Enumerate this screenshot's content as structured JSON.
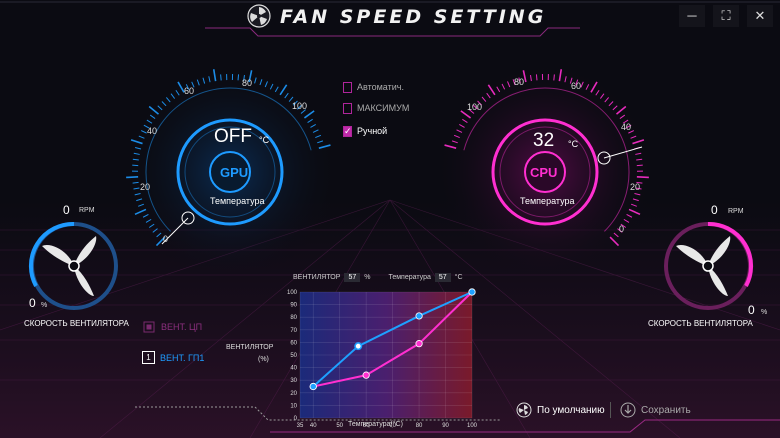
{
  "window": {
    "title": "FAN SPEED SETTING",
    "buttons": {
      "minimize": "─",
      "fullscreen": "⛶",
      "close": "✕"
    }
  },
  "gpu_gauge": {
    "label": "GPU",
    "temperature": "OFF",
    "unit": "°C",
    "caption": "Температура",
    "ticks": [
      "0",
      "20",
      "40",
      "60",
      "80",
      "100"
    ],
    "accent": "#1e9bff",
    "level": 0
  },
  "cpu_gauge": {
    "label": "CPU",
    "temperature": "32",
    "unit": "°C",
    "caption": "Температура",
    "ticks": [
      "0",
      "20",
      "40",
      "60",
      "80",
      "100"
    ],
    "accent": "#ff2fd0",
    "level": 32
  },
  "modes": [
    {
      "label": "Автоматич.",
      "selected": false
    },
    {
      "label": "МАКСИМУМ",
      "selected": false
    },
    {
      "label": "Ручной",
      "selected": true
    }
  ],
  "left_fan": {
    "rpm_value": "0",
    "rpm_unit": "RPM",
    "percent_value": "0",
    "percent_unit": "%",
    "caption": "СКОРОСТЬ ВЕНТИЛЯТОРА"
  },
  "right_fan": {
    "rpm_value": "0",
    "rpm_unit": "RPM",
    "percent_value": "0",
    "percent_unit": "%",
    "caption": "СКОРОСТЬ ВЕНТИЛЯТОРА"
  },
  "fan_selector": {
    "cpu": {
      "icon": "chip-icon",
      "label": "ВЕНТ. ЦП"
    },
    "gpu": {
      "icon": "chip-icon",
      "number": "1",
      "label": "ВЕНТ. ГП1"
    }
  },
  "readout": {
    "fan_label": "ВЕНТИЛЯТОР",
    "fan_value": "57",
    "fan_unit": "%",
    "temp_label": "Температура",
    "temp_value": "57",
    "temp_unit": "°C"
  },
  "chart_data": {
    "type": "line",
    "xlabel": "Температура(°C)",
    "ylabel_line1": "ВЕНТИЛЯТОР",
    "ylabel_line2": "(%)",
    "xlim": [
      35,
      100
    ],
    "ylim": [
      0,
      100
    ],
    "x_ticks": [
      "35",
      "40",
      "50",
      "60",
      "70",
      "80",
      "90",
      "100"
    ],
    "y_ticks": [
      "0",
      "10",
      "20",
      "30",
      "40",
      "50",
      "60",
      "70",
      "80",
      "90",
      "100"
    ],
    "series": [
      {
        "color": "#1ea0ff",
        "points": [
          [
            40,
            25
          ],
          [
            57,
            57
          ],
          [
            80,
            81
          ],
          [
            100,
            100
          ]
        ]
      },
      {
        "color": "#ff2fd0",
        "points": [
          [
            40,
            25
          ],
          [
            60,
            34
          ],
          [
            80,
            59
          ],
          [
            100,
            100
          ]
        ]
      }
    ]
  },
  "actions": {
    "default_label": "По умолчанию",
    "save_label": "Сохранить"
  },
  "colors": {
    "blue": "#1e9bff",
    "pink": "#ff2fd0",
    "background": "#0b0b12"
  }
}
